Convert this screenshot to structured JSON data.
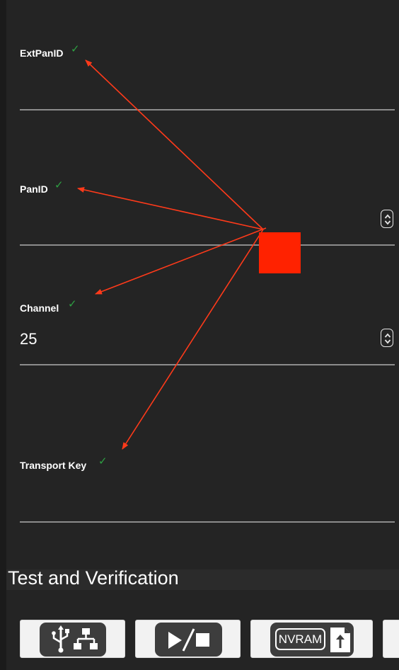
{
  "fields": [
    {
      "label": "ExtPanID",
      "value": "",
      "valid": true
    },
    {
      "label": "PanID",
      "value": "",
      "valid": true
    },
    {
      "label": "Channel",
      "value": "25",
      "valid": true
    },
    {
      "label": "Transport Key",
      "value": "",
      "valid": true
    }
  ],
  "check_glyph": "✓",
  "section": {
    "title": "Test and Verification"
  },
  "toolbar": {
    "buttons": [
      {
        "icon": "usb-network-icon"
      },
      {
        "icon": "play-stop-icon"
      },
      {
        "icon": "nvram-upload-icon",
        "text": "NVRAM"
      }
    ]
  },
  "colors": {
    "background": "#242424",
    "valid": "#2ea043",
    "annotation": "#ff2200"
  }
}
